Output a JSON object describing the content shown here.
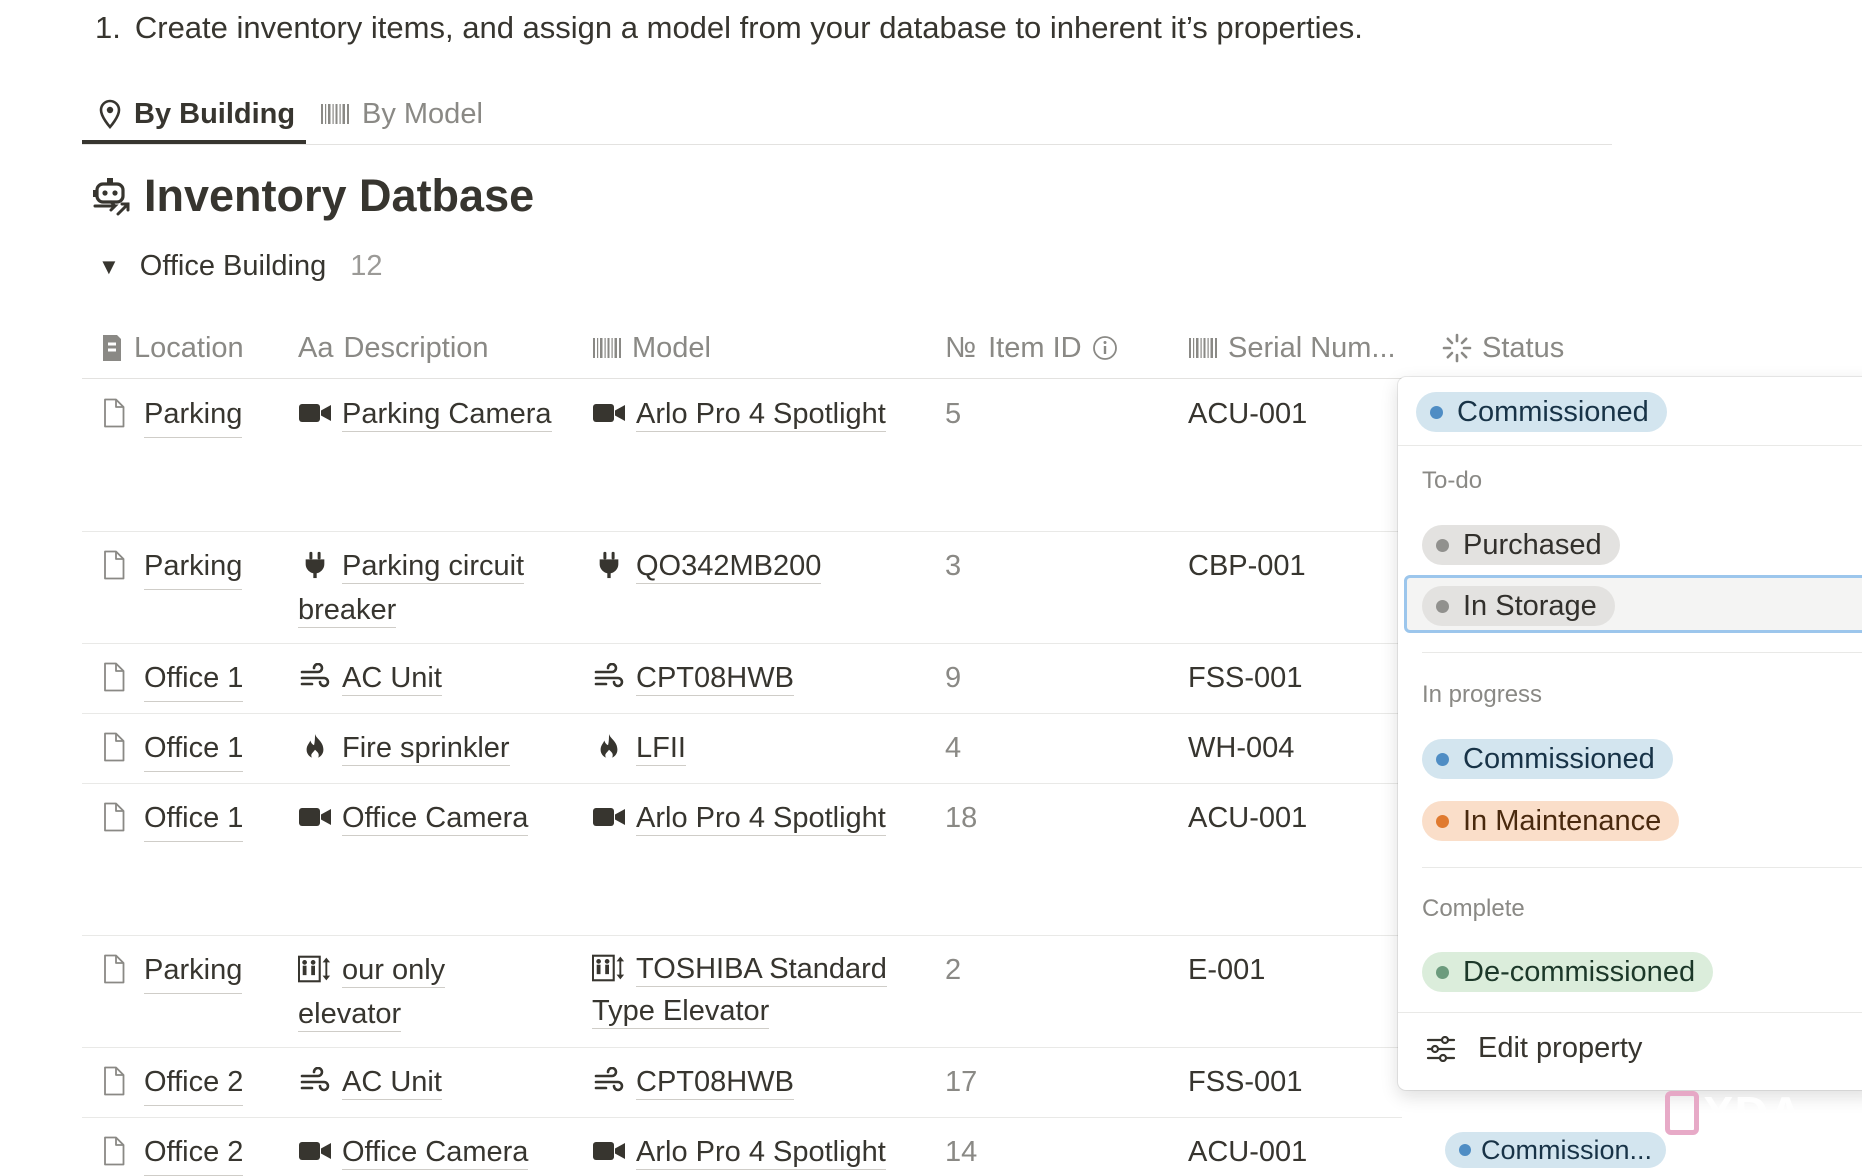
{
  "instruction": {
    "number": "1.",
    "text": "Create inventory items, and assign a model from your database to inherent it’s properties."
  },
  "tabs": [
    {
      "label": "By Building",
      "icon": "map-pin-icon",
      "active": true
    },
    {
      "label": "By Model",
      "icon": "barcode-icon",
      "active": false
    }
  ],
  "database": {
    "title": "Inventory Datbase",
    "icon": "robot-arrow-icon"
  },
  "group": {
    "name": "Office Building",
    "count": "12"
  },
  "columns": {
    "location": "Location",
    "description": "Description",
    "model": "Model",
    "item_id": "Item ID",
    "serial": "Serial Num...",
    "status": "Status",
    "description_prefix": "Aa",
    "item_id_prefix": "№"
  },
  "rows": [
    {
      "location": "Parking",
      "description": "Parking Camera",
      "desc_icon": "camera-icon",
      "model": "Arlo Pro 4 Spotlight",
      "model_icon": "camera-icon",
      "item_id": "5",
      "serial": "ACU-001"
    },
    {
      "location": "Parking",
      "description": "Parking circuit breaker",
      "desc_icon": "plug-icon",
      "model": "QO342MB200",
      "model_icon": "plug-icon",
      "item_id": "3",
      "serial": "CBP-001"
    },
    {
      "location": "Office 1",
      "description": "AC Unit",
      "desc_icon": "wind-icon",
      "model": "CPT08HWB",
      "model_icon": "wind-icon",
      "item_id": "9",
      "serial": "FSS-001"
    },
    {
      "location": "Office 1",
      "description": "Fire sprinkler",
      "desc_icon": "fire-icon",
      "model": "LFII",
      "model_icon": "fire-icon",
      "item_id": "4",
      "serial": "WH-004"
    },
    {
      "location": "Office 1",
      "description": "Office Camera",
      "desc_icon": "camera-icon",
      "model": "Arlo Pro 4 Spotlight",
      "model_icon": "camera-icon",
      "item_id": "18",
      "serial": "ACU-001"
    },
    {
      "location": "Parking",
      "description": "our only elevator",
      "desc_icon": "elevator-icon",
      "model": "TOSHIBA Standard Type Elevator",
      "model_icon": "elevator-icon",
      "item_id": "2",
      "serial": "E-001"
    },
    {
      "location": "Office 2",
      "description": "AC Unit",
      "desc_icon": "wind-icon",
      "model": "CPT08HWB",
      "model_icon": "wind-icon",
      "item_id": "17",
      "serial": "FSS-001"
    },
    {
      "location": "Office 2",
      "description": "Office Camera",
      "desc_icon": "camera-icon",
      "model": "Arlo Pro 4 Spotlight",
      "model_icon": "camera-icon",
      "item_id": "14",
      "serial": "ACU-001",
      "status": "Commission..."
    }
  ],
  "status_menu": {
    "current": "Commissioned",
    "groups": [
      {
        "label": "To-do",
        "options": [
          "Purchased",
          "In Storage"
        ]
      },
      {
        "label": "In progress",
        "options": [
          "Commissioned",
          "In Maintenance"
        ]
      },
      {
        "label": "Complete",
        "options": [
          "De-commissioned"
        ]
      }
    ],
    "hovered_option": "In Storage",
    "edit_label": "Edit property"
  },
  "colors": {
    "blue": "#d3e5ef",
    "gray": "#e3e2e0",
    "orange": "#fadec9",
    "green": "#dbeddb",
    "hover_border": "#9cc6ec"
  },
  "watermark": "XDA"
}
